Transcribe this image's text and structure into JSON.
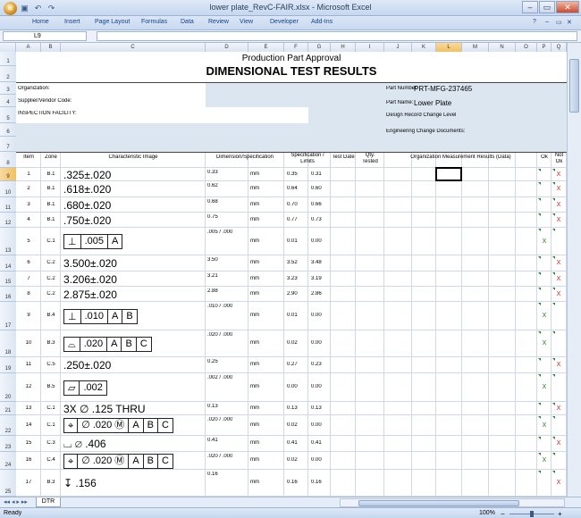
{
  "window": {
    "title": "lower plate_RevC-FAIR.xlsx - Microsoft Excel",
    "office_button_label": "⊞",
    "qat_icons": [
      "save-icon",
      "undo-icon",
      "redo-icon"
    ],
    "min_label": "–",
    "max_label": "▭",
    "close_label": "✕"
  },
  "ribbon": {
    "tabs": [
      "Home",
      "Insert",
      "Page Layout",
      "Formulas",
      "Data",
      "Review",
      "View",
      "Developer",
      "Add-Ins"
    ],
    "help_label": "?",
    "min_label": "–",
    "restore_label": "▭",
    "close_label": "✕"
  },
  "formula_bar": {
    "name_box": "L9",
    "fx_label": "fx",
    "formula": ""
  },
  "columns": [
    "A",
    "B",
    "C",
    "D",
    "E",
    "F",
    "G",
    "H",
    "I",
    "J",
    "K",
    "L",
    "M",
    "N",
    "O",
    "P",
    "Q"
  ],
  "selected_column": "L",
  "selected_row": "9",
  "rows": [
    "1",
    "2",
    "3",
    "4",
    "5",
    "6",
    "7",
    "8",
    "9",
    "10",
    "11",
    "12",
    "13",
    "14",
    "15",
    "16",
    "17",
    "18",
    "19",
    "20",
    "21",
    "22",
    "23",
    "24",
    "25"
  ],
  "header": {
    "title_small": "Production Part Approval",
    "title_big": "DIMENSIONAL TEST RESULTS",
    "organization_label": "Organization:",
    "supplier_label": "Supplier/Vendor Code:",
    "facility_label": "INSPECTION FACILITY:",
    "part_number_label": "Part Number:",
    "part_number": "PRT-MFG-237465",
    "part_name_label": "Part Name:",
    "part_name": "Lower Plate",
    "design_record_label": "Design Record Change Level",
    "eng_change_label": "Engineering Change Documents:"
  },
  "table_headers": {
    "item": "Item",
    "zone": "Zone",
    "char_image": "Characteristic Image",
    "dim_spec": "Dimension/Specification",
    "spec_limits_1": "Specification /",
    "spec_limits_2": "Limits",
    "test_date": "Test Date",
    "qty_1": "Qty.",
    "qty_2": "Tested",
    "org_results": "Organization Measurement Results (Data)",
    "ok": "Ok",
    "not_ok_1": "Not",
    "not_ok_2": "Ok"
  },
  "table_rows": [
    {
      "item": "1",
      "zone": "B.1",
      "image": ".325±.020",
      "dim": "0.33",
      "unit": "mm",
      "lo": "0.35",
      "hi": "0.31",
      "ok": "",
      "nok": "X"
    },
    {
      "item": "2",
      "zone": "B.1",
      "image": ".618±.020",
      "dim": "0.62",
      "unit": "mm",
      "lo": "0.64",
      "hi": "0.60",
      "ok": "",
      "nok": "X"
    },
    {
      "item": "3",
      "zone": "B.1",
      "image": ".680±.020",
      "dim": "0.68",
      "unit": "mm",
      "lo": "0.70",
      "hi": "0.66",
      "ok": "",
      "nok": "X"
    },
    {
      "item": "4",
      "zone": "B.1",
      "image": ".750±.020",
      "dim": "0.75",
      "unit": "mm",
      "lo": "0.77",
      "hi": "0.73",
      "ok": "",
      "nok": "X"
    },
    {
      "item": "5",
      "zone": "C.1",
      "fcf": [
        "⊥",
        ".005",
        "A"
      ],
      "dim": ".005  /  .000",
      "unit": "mm",
      "lo": "0.01",
      "hi": "0.00",
      "ok": "X",
      "nok": ""
    },
    {
      "item": "6",
      "zone": "C.2",
      "image": "3.500±.020",
      "dim": "3.50",
      "unit": "mm",
      "lo": "3.52",
      "hi": "3.48",
      "ok": "",
      "nok": "X"
    },
    {
      "item": "7",
      "zone": "C.2",
      "image": "3.206±.020",
      "dim": "3.21",
      "unit": "mm",
      "lo": "3.23",
      "hi": "3.19",
      "ok": "",
      "nok": "X"
    },
    {
      "item": "8",
      "zone": "C.2",
      "image": "2.875±.020",
      "dim": "2.88",
      "unit": "mm",
      "lo": "2.90",
      "hi": "2.86",
      "ok": "",
      "nok": "X"
    },
    {
      "item": "9",
      "zone": "B.4",
      "fcf": [
        "⊥",
        ".010",
        "A",
        "B"
      ],
      "dim": ".010  /  .000",
      "unit": "mm",
      "lo": "0.01",
      "hi": "0.00",
      "ok": "X",
      "nok": ""
    },
    {
      "item": "10",
      "zone": "B.3",
      "fcf": [
        "⌓",
        ".020",
        "A",
        "B",
        "C"
      ],
      "dim": ".020  /  .000",
      "unit": "mm",
      "lo": "0.02",
      "hi": "0.00",
      "ok": "X",
      "nok": ""
    },
    {
      "item": "11",
      "zone": "C.5",
      "image": ".250±.020",
      "dim": "0.25",
      "unit": "mm",
      "lo": "0.27",
      "hi": "0.23",
      "ok": "",
      "nok": "X"
    },
    {
      "item": "12",
      "zone": "B.5",
      "fcf": [
        "▱",
        ".002"
      ],
      "dim": ".002  /  .000",
      "unit": "mm",
      "lo": "0.00",
      "hi": "0.00",
      "ok": "X",
      "nok": ""
    },
    {
      "item": "13",
      "zone": "C.1",
      "image": "3X  ∅ .125 THRU",
      "dim": "0.13",
      "unit": "mm",
      "lo": "0.13",
      "hi": "0.13",
      "ok": "",
      "nok": "X"
    },
    {
      "item": "14",
      "zone": "C.1",
      "fcf": [
        "⌖",
        "∅ .020 Ⓜ",
        "A",
        "B",
        "C"
      ],
      "dim": ".020  /  .000",
      "unit": "mm",
      "lo": "0.02",
      "hi": "0.00",
      "ok": "X",
      "nok": ""
    },
    {
      "item": "15",
      "zone": "C.3",
      "image": "⌴  ∅ .406",
      "dim": "0.41",
      "unit": "mm",
      "lo": "0.41",
      "hi": "0.41",
      "ok": "",
      "nok": "X"
    },
    {
      "item": "16",
      "zone": "C.4",
      "fcf": [
        "⌖",
        "∅ .020 Ⓜ",
        "A",
        "B",
        "C"
      ],
      "dim": ".020  /  .000",
      "unit": "mm",
      "lo": "0.02",
      "hi": "0.00",
      "ok": "X",
      "nok": ""
    },
    {
      "item": "17",
      "zone": "B.3",
      "image": "↧ .156",
      "dim": "0.16",
      "unit": "mm",
      "lo": "0.16",
      "hi": "0.16",
      "ok": "",
      "nok": "X"
    }
  ],
  "sheet_tabs": [
    "DTR"
  ],
  "status": {
    "left": "Ready",
    "zoom": "100%",
    "minus": "−",
    "plus": "+"
  },
  "colors": {
    "ok": "#1a7a1a",
    "not_ok": "#d21a1a",
    "shade": "#dce6f1",
    "ribbon": "#c9d9ef"
  }
}
